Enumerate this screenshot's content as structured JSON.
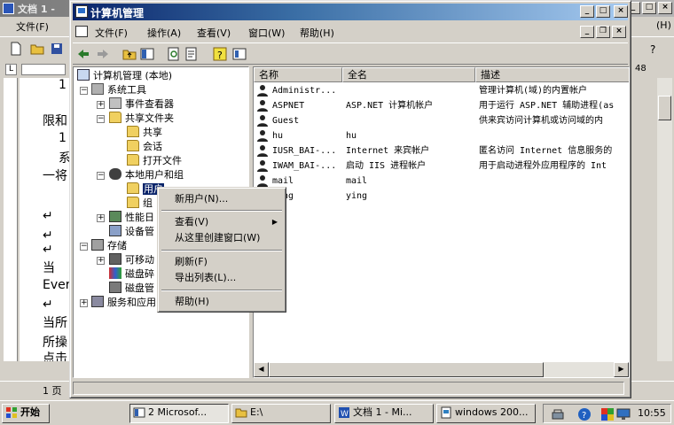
{
  "word": {
    "title": "文档 1 - ",
    "menu": {
      "file": "文件(F)",
      "right_label": "(H)"
    },
    "zoom_hint": "48",
    "ruler_mark": "L",
    "page_lines": [
      "1",
      "限和",
      "1",
      "系",
      "一将",
      "↵",
      "↵",
      "↵",
      "当",
      "Ever",
      "↵",
      "当所",
      "所操",
      "点击"
    ],
    "status_page": "1 页"
  },
  "cm": {
    "title": "计算机管理",
    "menu": [
      "文件(F)",
      "操作(A)",
      "查看(V)",
      "窗口(W)",
      "帮助(H)"
    ],
    "tree": {
      "root": "计算机管理 (本地)",
      "system_tools": "系统工具",
      "event_viewer": "事件查看器",
      "shared_folders": "共享文件夹",
      "shares": "共享",
      "sessions": "会话",
      "open_files": "打开文件",
      "local_users_groups": "本地用户和组",
      "users": "用户",
      "groups": "组",
      "perf_logs": "性能日",
      "device_mgr": "设备管",
      "storage": "存储",
      "removable": "可移动",
      "disk_defrag": "磁盘碎",
      "disk_mgmt": "磁盘管",
      "services_apps": "服务和应用"
    },
    "columns": [
      "名称",
      "全名",
      "描述"
    ],
    "users": [
      {
        "name": "Administr...",
        "full": "",
        "desc": "管理计算机(域)的内置帐户"
      },
      {
        "name": "ASPNET",
        "full": "ASP.NET 计算机帐户",
        "desc": "用于运行 ASP.NET 辅助进程(as"
      },
      {
        "name": "Guest",
        "full": "",
        "desc": "供来宾访问计算机或访问域的内"
      },
      {
        "name": "hu",
        "full": "hu",
        "desc": ""
      },
      {
        "name": "IUSR_BAI-...",
        "full": "Internet 来宾帐户",
        "desc": "匿名访问 Internet 信息服务的"
      },
      {
        "name": "IWAM_BAI-...",
        "full": "启动 IIS 进程帐户",
        "desc": "用于启动进程外应用程序的 Int"
      },
      {
        "name": "mail",
        "full": "mail",
        "desc": ""
      },
      {
        "name": "ying",
        "full": "ying",
        "desc": ""
      }
    ]
  },
  "context_menu": {
    "new_user": "新用户(N)...",
    "view": "查看(V)",
    "new_window": "从这里创建窗口(W)",
    "refresh": "刷新(F)",
    "export": "导出列表(L)...",
    "help": "帮助(H)"
  },
  "taskbar": {
    "start": "开始",
    "buttons": [
      "2 Microsof...",
      "E:\\",
      "文档 1 - Mi...",
      "windows 200..."
    ],
    "clock": "10:55"
  },
  "colors": {
    "title_active": "#0a246a",
    "selection": "#0a246a",
    "face": "#d4d0c8"
  }
}
